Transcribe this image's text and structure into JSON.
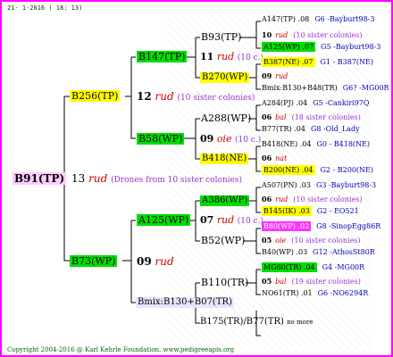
{
  "date": "21- 1-2016 ( 18: 13)",
  "copyright": "Copyright 2004-2016 @ Karl Kehrle Foundation.   www.pedigreeapis.org",
  "root": {
    "name": "B91(TP)",
    "color": "#ffccff",
    "generation": "13",
    "rud": "rud",
    "note": "(Drones from 10 sister colonies)"
  },
  "gen1": [
    {
      "name": "B256(TP)",
      "generation": "12",
      "rud": "rud",
      "note": "(10 sister colonies)"
    },
    {
      "name": "B73(WP)",
      "generation": "09",
      "rud": "rud",
      "note": ""
    }
  ],
  "gen2": [
    {
      "name": "B147(TP)",
      "generation": "11",
      "rud": "rud",
      "note": "(10 c.)"
    },
    {
      "name": "B58(WP)",
      "generation": "09",
      "rud": "oie",
      "note": "(10 c.)"
    },
    {
      "name": "A125(WP)",
      "generation": "07",
      "rud": "rud",
      "note": "(10 c.)"
    },
    {
      "name": "Bmix:B130+B07(TR)",
      "generation": "",
      "rud": "",
      "note": ""
    }
  ],
  "gen3": [
    {
      "name": "B93(TP)"
    },
    {
      "name": "B270(WP)"
    },
    {
      "name": "A288(WP)"
    },
    {
      "name": "B418(NE)"
    },
    {
      "name": "A386(WP)"
    },
    {
      "name": "B52(WP)"
    },
    {
      "name": "B110(TR)"
    },
    {
      "name": "B175(TR)/B77(TR)",
      "extra": "no more"
    }
  ],
  "gen4": [
    {
      "a": "A147(TP) .08",
      "b": "G6 -Bayburt98-3"
    },
    {
      "a": "10",
      "rud": "rud",
      "b": "(10 sister colonies)"
    },
    {
      "a": "A125(WP) .07",
      "b": "G5 -Bayburt98-3"
    },
    {
      "a": "B387(NE) .07",
      "b": "G1 - B387(NE)"
    },
    {
      "a": "09",
      "rud": "rud",
      "b": ""
    },
    {
      "a": "Bmix:B130+B48(TR)",
      "b": "G6? -MG00R"
    },
    {
      "a": "A284(PJ) .04",
      "b": "G5 -Cankiri97Q"
    },
    {
      "a": "06",
      "rud": "bal",
      "b": "(18 sister colonies)"
    },
    {
      "a": "B77(TR) .04",
      "b": "G8 -Old_Lady"
    },
    {
      "a": "B418(NE) .04",
      "b": "G0 - B418(NE)"
    },
    {
      "a": "06",
      "rud": "nat",
      "b": ""
    },
    {
      "a": "B200(NE) .04",
      "b": "G2 - B200(NE)"
    },
    {
      "a": "A507(PN) .03",
      "b": "G3 -Bayburt98-3"
    },
    {
      "a": "06",
      "rud": "rud",
      "b": "(10 sister colonies)"
    },
    {
      "a": "B145(IK) .03",
      "b": "G2 - EO521"
    },
    {
      "a": "B80(WP) .02",
      "b": "G8 -SinopEgg86R"
    },
    {
      "a": "05",
      "rud": "oie",
      "b": "(10 sister colonies)"
    },
    {
      "a": "B40(WP) .03",
      "b": "G12 -AthosSt80R"
    },
    {
      "a": "MG60(TR) .04",
      "b": "G4 -MG00R"
    },
    {
      "a": "05",
      "rud": "bal",
      "b": "(19 sister colonies)"
    },
    {
      "a": "NO61(TR) .01",
      "b": "G6 -NO6294R"
    }
  ]
}
